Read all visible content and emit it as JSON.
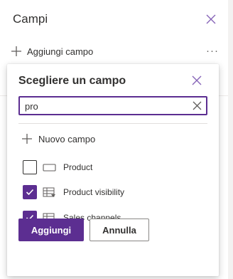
{
  "panel": {
    "title": "Campi",
    "add_field_label": "Aggiungi campo",
    "more_label": "···"
  },
  "callout": {
    "title": "Scegliere un campo",
    "search_value": "pro",
    "new_field_label": "Nuovo campo",
    "options": [
      {
        "label": "Product",
        "checked": false,
        "icon": "single-line-field-icon"
      },
      {
        "label": "Product visibility",
        "checked": true,
        "icon": "choice-field-icon"
      },
      {
        "label": "Sales channels",
        "checked": true,
        "icon": "choice-field-icon"
      }
    ],
    "confirm_label": "Aggiungi",
    "cancel_label": "Annulla"
  },
  "colors": {
    "accent": "#5c2e91",
    "text": "#323130",
    "panel_edge": "#f3f2f1"
  }
}
